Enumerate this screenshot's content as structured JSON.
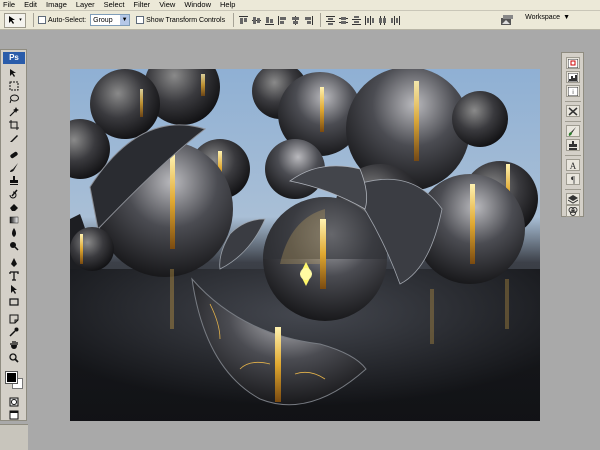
{
  "menubar": {
    "items": [
      "File",
      "Edit",
      "Image",
      "Layer",
      "Select",
      "Filter",
      "View",
      "Window",
      "Help"
    ]
  },
  "optionsbar": {
    "auto_select_label": "Auto-Select:",
    "auto_select_value": "Group",
    "show_transform_label": "Show Transform Controls",
    "workspace_label": "Workspace"
  },
  "toolspanel": {
    "logo": "Ps",
    "tools": [
      "move-tool-icon",
      "marquee-tool-icon",
      "lasso-tool-icon",
      "magic-wand-icon",
      "crop-tool-icon",
      "slice-tool-icon",
      "healing-brush-icon",
      "brush-tool-icon",
      "clone-stamp-icon",
      "history-brush-icon",
      "eraser-icon",
      "gradient-tool-icon",
      "blur-tool-icon",
      "dodge-tool-icon",
      "pen-tool-icon",
      "type-tool-icon",
      "path-selection-icon",
      "shape-tool-icon",
      "notes-tool-icon",
      "eyedropper-icon",
      "hand-tool-icon",
      "zoom-tool-icon"
    ]
  },
  "colors": {
    "foreground": "#000000",
    "background": "#ffffff",
    "ps_blue": "#2a5caa",
    "chrome": "#ece9d8",
    "workspace_gray": "#a9a9a9"
  },
  "rightdock": {
    "buttons": [
      "navigator-icon",
      "histogram-icon",
      "info-icon",
      "tool-presets-icon",
      "brushes-icon",
      "clone-source-icon",
      "character-icon",
      "paragraph-icon",
      "layers-icon",
      "channels-icon",
      "paths-icon"
    ]
  }
}
